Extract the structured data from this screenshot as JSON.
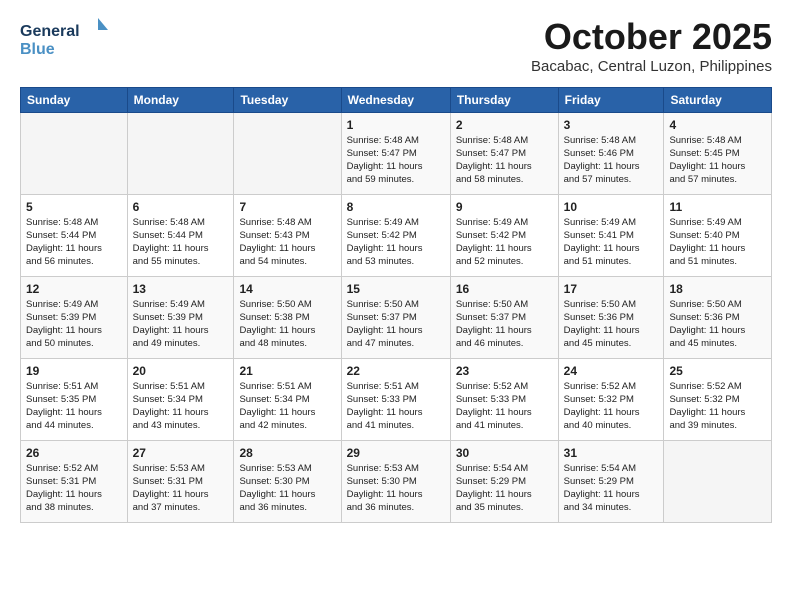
{
  "header": {
    "logo_line1": "General",
    "logo_line2": "Blue",
    "month": "October 2025",
    "location": "Bacabac, Central Luzon, Philippines"
  },
  "weekdays": [
    "Sunday",
    "Monday",
    "Tuesday",
    "Wednesday",
    "Thursday",
    "Friday",
    "Saturday"
  ],
  "weeks": [
    [
      {
        "day": "",
        "info": ""
      },
      {
        "day": "",
        "info": ""
      },
      {
        "day": "",
        "info": ""
      },
      {
        "day": "1",
        "info": "Sunrise: 5:48 AM\nSunset: 5:47 PM\nDaylight: 11 hours\nand 59 minutes."
      },
      {
        "day": "2",
        "info": "Sunrise: 5:48 AM\nSunset: 5:47 PM\nDaylight: 11 hours\nand 58 minutes."
      },
      {
        "day": "3",
        "info": "Sunrise: 5:48 AM\nSunset: 5:46 PM\nDaylight: 11 hours\nand 57 minutes."
      },
      {
        "day": "4",
        "info": "Sunrise: 5:48 AM\nSunset: 5:45 PM\nDaylight: 11 hours\nand 57 minutes."
      }
    ],
    [
      {
        "day": "5",
        "info": "Sunrise: 5:48 AM\nSunset: 5:44 PM\nDaylight: 11 hours\nand 56 minutes."
      },
      {
        "day": "6",
        "info": "Sunrise: 5:48 AM\nSunset: 5:44 PM\nDaylight: 11 hours\nand 55 minutes."
      },
      {
        "day": "7",
        "info": "Sunrise: 5:48 AM\nSunset: 5:43 PM\nDaylight: 11 hours\nand 54 minutes."
      },
      {
        "day": "8",
        "info": "Sunrise: 5:49 AM\nSunset: 5:42 PM\nDaylight: 11 hours\nand 53 minutes."
      },
      {
        "day": "9",
        "info": "Sunrise: 5:49 AM\nSunset: 5:42 PM\nDaylight: 11 hours\nand 52 minutes."
      },
      {
        "day": "10",
        "info": "Sunrise: 5:49 AM\nSunset: 5:41 PM\nDaylight: 11 hours\nand 51 minutes."
      },
      {
        "day": "11",
        "info": "Sunrise: 5:49 AM\nSunset: 5:40 PM\nDaylight: 11 hours\nand 51 minutes."
      }
    ],
    [
      {
        "day": "12",
        "info": "Sunrise: 5:49 AM\nSunset: 5:39 PM\nDaylight: 11 hours\nand 50 minutes."
      },
      {
        "day": "13",
        "info": "Sunrise: 5:49 AM\nSunset: 5:39 PM\nDaylight: 11 hours\nand 49 minutes."
      },
      {
        "day": "14",
        "info": "Sunrise: 5:50 AM\nSunset: 5:38 PM\nDaylight: 11 hours\nand 48 minutes."
      },
      {
        "day": "15",
        "info": "Sunrise: 5:50 AM\nSunset: 5:37 PM\nDaylight: 11 hours\nand 47 minutes."
      },
      {
        "day": "16",
        "info": "Sunrise: 5:50 AM\nSunset: 5:37 PM\nDaylight: 11 hours\nand 46 minutes."
      },
      {
        "day": "17",
        "info": "Sunrise: 5:50 AM\nSunset: 5:36 PM\nDaylight: 11 hours\nand 45 minutes."
      },
      {
        "day": "18",
        "info": "Sunrise: 5:50 AM\nSunset: 5:36 PM\nDaylight: 11 hours\nand 45 minutes."
      }
    ],
    [
      {
        "day": "19",
        "info": "Sunrise: 5:51 AM\nSunset: 5:35 PM\nDaylight: 11 hours\nand 44 minutes."
      },
      {
        "day": "20",
        "info": "Sunrise: 5:51 AM\nSunset: 5:34 PM\nDaylight: 11 hours\nand 43 minutes."
      },
      {
        "day": "21",
        "info": "Sunrise: 5:51 AM\nSunset: 5:34 PM\nDaylight: 11 hours\nand 42 minutes."
      },
      {
        "day": "22",
        "info": "Sunrise: 5:51 AM\nSunset: 5:33 PM\nDaylight: 11 hours\nand 41 minutes."
      },
      {
        "day": "23",
        "info": "Sunrise: 5:52 AM\nSunset: 5:33 PM\nDaylight: 11 hours\nand 41 minutes."
      },
      {
        "day": "24",
        "info": "Sunrise: 5:52 AM\nSunset: 5:32 PM\nDaylight: 11 hours\nand 40 minutes."
      },
      {
        "day": "25",
        "info": "Sunrise: 5:52 AM\nSunset: 5:32 PM\nDaylight: 11 hours\nand 39 minutes."
      }
    ],
    [
      {
        "day": "26",
        "info": "Sunrise: 5:52 AM\nSunset: 5:31 PM\nDaylight: 11 hours\nand 38 minutes."
      },
      {
        "day": "27",
        "info": "Sunrise: 5:53 AM\nSunset: 5:31 PM\nDaylight: 11 hours\nand 37 minutes."
      },
      {
        "day": "28",
        "info": "Sunrise: 5:53 AM\nSunset: 5:30 PM\nDaylight: 11 hours\nand 36 minutes."
      },
      {
        "day": "29",
        "info": "Sunrise: 5:53 AM\nSunset: 5:30 PM\nDaylight: 11 hours\nand 36 minutes."
      },
      {
        "day": "30",
        "info": "Sunrise: 5:54 AM\nSunset: 5:29 PM\nDaylight: 11 hours\nand 35 minutes."
      },
      {
        "day": "31",
        "info": "Sunrise: 5:54 AM\nSunset: 5:29 PM\nDaylight: 11 hours\nand 34 minutes."
      },
      {
        "day": "",
        "info": ""
      }
    ]
  ]
}
